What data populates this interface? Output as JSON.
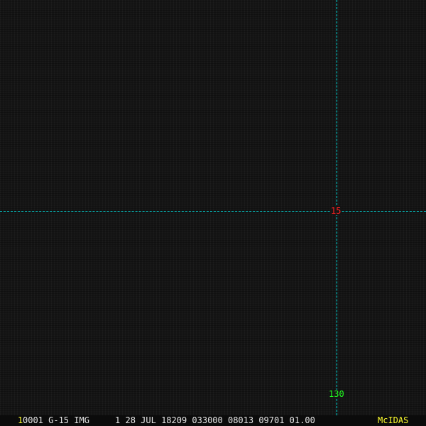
{
  "image": {
    "grid": {
      "latitude_label": "15",
      "longitude_label": "130",
      "line_color": "#00e0e0",
      "lat_color": "#ff2020",
      "lon_color": "#20ff20"
    },
    "status_bar": {
      "frame_number": "1",
      "info": "0001 G-15 IMG     1 28 JUL 18209 033000 08013 09701 01.00",
      "brand": "McIDAS"
    }
  }
}
